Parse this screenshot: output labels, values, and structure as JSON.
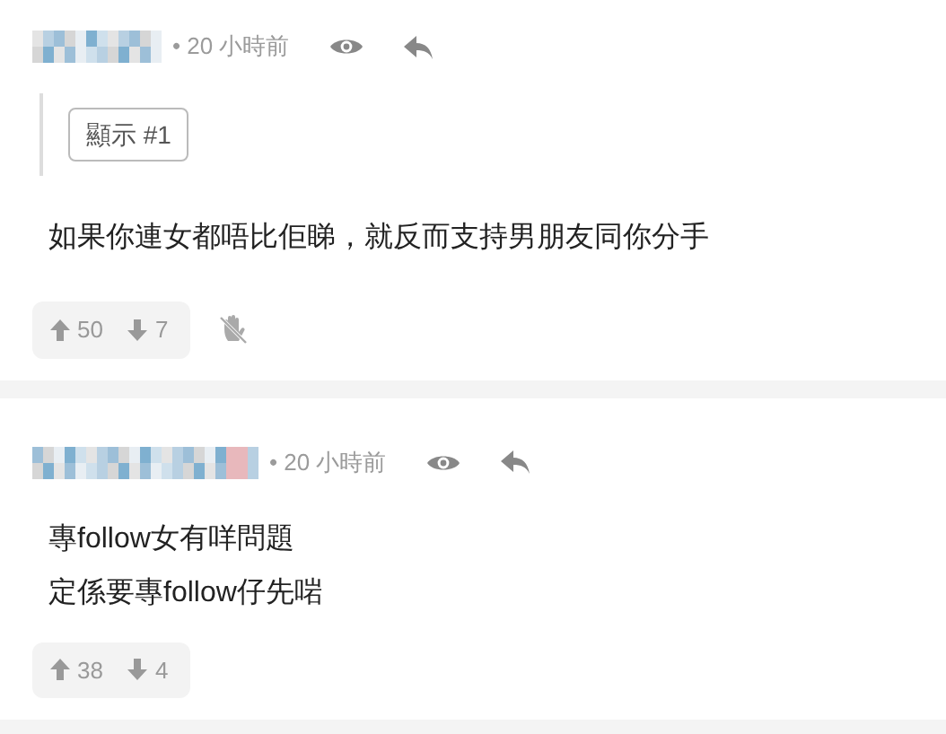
{
  "comments": [
    {
      "time": "• 20 小時前",
      "quote_button": "顯示 #1",
      "lines": [
        "如果你連女都唔比佢睇，就反而支持男朋友同你分手"
      ],
      "upvotes": "50",
      "downvotes": "7",
      "hand_icon": true
    },
    {
      "time": "• 20 小時前",
      "lines": [
        "專follow女有咩問題",
        "定係要專follow仔先啱"
      ],
      "upvotes": "38",
      "downvotes": "4",
      "hand_icon": false
    }
  ]
}
